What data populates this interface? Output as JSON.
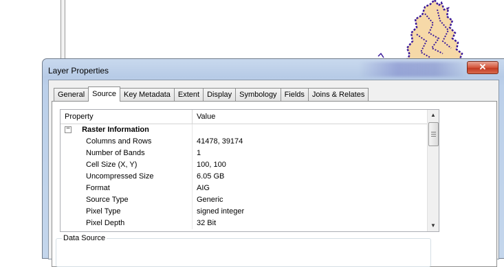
{
  "dialog": {
    "title": "Layer Properties",
    "close_glyph": "✕"
  },
  "tabs": [
    {
      "label": "General",
      "active": false
    },
    {
      "label": "Source",
      "active": true
    },
    {
      "label": "Key Metadata",
      "active": false
    },
    {
      "label": "Extent",
      "active": false
    },
    {
      "label": "Display",
      "active": false
    },
    {
      "label": "Symbology",
      "active": false
    },
    {
      "label": "Fields",
      "active": false
    },
    {
      "label": "Joins & Relates",
      "active": false
    }
  ],
  "grid": {
    "header_property": "Property",
    "header_value": "Value",
    "group_label": "Raster Information",
    "group_expander": "−",
    "rows": [
      {
        "name": "Columns and Rows",
        "value": "41478, 39174"
      },
      {
        "name": "Number of Bands",
        "value": "1"
      },
      {
        "name": "Cell Size (X, Y)",
        "value": "100, 100"
      },
      {
        "name": "Uncompressed Size",
        "value": "6.05 GB"
      },
      {
        "name": "Format",
        "value": "AIG"
      },
      {
        "name": "Source Type",
        "value": "Generic"
      },
      {
        "name": "Pixel Type",
        "value": "signed integer"
      },
      {
        "name": "Pixel Depth",
        "value": "32 Bit"
      }
    ],
    "scroll_up_glyph": "▲",
    "scroll_down_glyph": "▼"
  },
  "data_source": {
    "label": "Data Source"
  },
  "colors": {
    "map_fill": "#f6d9a8",
    "map_stroke": "#3b1a9a"
  }
}
